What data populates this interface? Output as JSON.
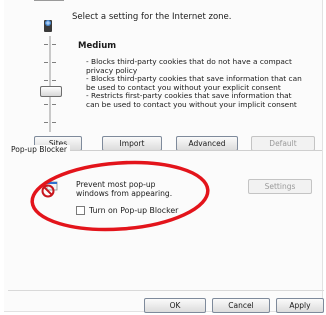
{
  "zone": {
    "instruction": "Select a setting for the Internet zone.",
    "level": "Medium",
    "description_lines": [
      "- Blocks third-party cookies that do not have a compact",
      "privacy policy",
      "- Blocks third-party cookies that save information that can",
      "be used to contact you without your explicit consent",
      "- Restricts first-party cookies that save information that",
      "can be used to contact you without your implicit consent"
    ]
  },
  "buttons": {
    "sites": "Sites",
    "import": "Import",
    "advanced": "Advanced",
    "default": "Default"
  },
  "popup_blocker": {
    "group_label": "Pop-up Blocker",
    "text": "Prevent most pop-up windows from appearing.",
    "checkbox_label": "Turn on Pop-up Blocker",
    "checkbox_checked": false,
    "settings_button": "Settings"
  },
  "dialog_buttons": {
    "ok": "OK",
    "cancel": "Cancel",
    "apply": "Apply"
  },
  "colors": {
    "highlight_ring": "#e3141b",
    "no_sign": "#c8161d"
  },
  "icons": [
    "globe-zone-icon",
    "popup-blocked-icon"
  ]
}
